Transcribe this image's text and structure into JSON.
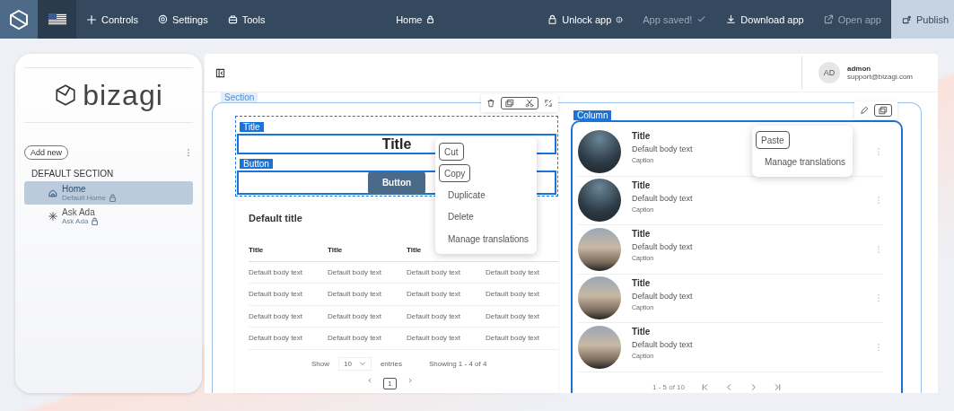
{
  "topbar": {
    "controls": "Controls",
    "settings": "Settings",
    "tools": "Tools",
    "page_title": "Home",
    "page_locked": true,
    "actions": [
      {
        "kind": "unlock",
        "label": "Unlock app",
        "disabled": false
      },
      {
        "kind": "status",
        "label": "App saved!",
        "disabled": true
      },
      {
        "kind": "download",
        "label": "Download app",
        "disabled": false
      },
      {
        "kind": "open",
        "label": "Open app",
        "disabled": true
      },
      {
        "kind": "publish",
        "label": "Publish",
        "disabled": false
      }
    ]
  },
  "sidebar": {
    "logo_text": "bizagi",
    "add_new": "Add new",
    "section_title": "DEFAULT SECTION",
    "pages": [
      {
        "kind": "home",
        "name": "Home",
        "subtitle": "Default Home",
        "locked": true,
        "selected": true
      },
      {
        "kind": "assistant",
        "name": "Ask Ada",
        "subtitle": "Ask Ada",
        "locked": true,
        "selected": false
      }
    ]
  },
  "user": {
    "initials": "AD",
    "name": "admon",
    "email": "support@bizagi.com"
  },
  "section": {
    "label": "Section"
  },
  "title_block": {
    "tag": "Title",
    "text": "Title"
  },
  "button_block": {
    "tag": "Button",
    "text": "Button"
  },
  "table": {
    "title": "Default title",
    "columns": [
      "Title",
      "Title",
      "Title"
    ],
    "rows": [
      [
        "Default body text",
        "Default body text",
        "Default body text",
        "Default body text"
      ],
      [
        "Default body text",
        "Default body text",
        "Default body text",
        "Default body text"
      ],
      [
        "Default body text",
        "Default body text",
        "Default body text",
        "Default body text"
      ],
      [
        "Default body text",
        "Default body text",
        "Default body text",
        "Default body text"
      ]
    ],
    "show_label": "Show",
    "page_size": "10",
    "entries_label": "entries",
    "summary": "Showing 1 - 4 of 4",
    "pages": [
      {
        "label": "1",
        "selected": true
      }
    ]
  },
  "context_menu": {
    "items": [
      {
        "label": "Cut",
        "highlighted": true
      },
      {
        "label": "Copy",
        "highlighted": true
      },
      {
        "label": "Duplicate",
        "highlighted": false
      },
      {
        "label": "Delete",
        "highlighted": false
      },
      {
        "label": "Manage translations",
        "highlighted": false
      }
    ]
  },
  "column": {
    "tag": "Column",
    "summary": "1 - 5 of 10",
    "items": [
      {
        "kind": "skyline",
        "title": "Title",
        "body": "Default body text",
        "caption": "Caption"
      },
      {
        "kind": "skyline",
        "title": "Title",
        "body": "Default body text",
        "caption": "Caption"
      },
      {
        "kind": "building",
        "title": "Title",
        "body": "Default body text",
        "caption": "Caption"
      },
      {
        "kind": "building",
        "title": "Title",
        "body": "Default body text",
        "caption": "Caption"
      },
      {
        "kind": "building",
        "title": "Title",
        "body": "Default body text",
        "caption": "Caption"
      }
    ]
  },
  "paste_menu": {
    "items": [
      {
        "label": "Paste",
        "highlighted": true
      },
      {
        "label": "Manage translations",
        "highlighted": false
      }
    ]
  }
}
